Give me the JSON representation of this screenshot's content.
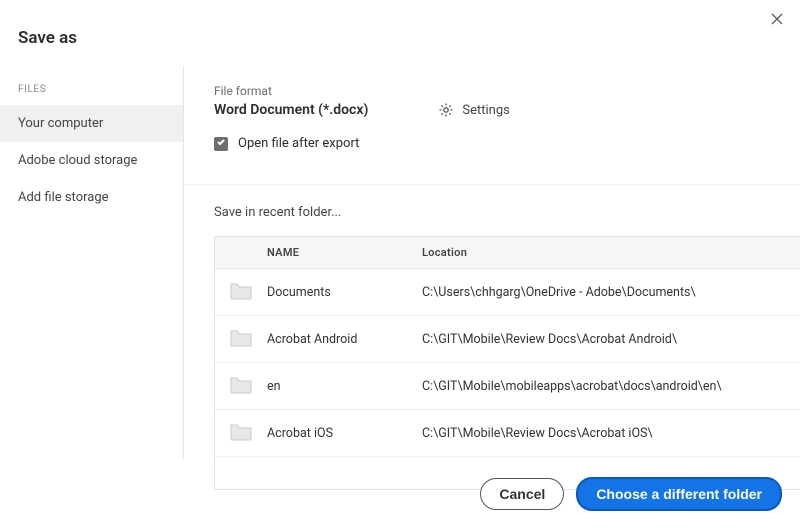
{
  "dialog": {
    "title": "Save as"
  },
  "sidebar": {
    "heading": "FILES",
    "items": [
      {
        "label": "Your computer",
        "selected": true
      },
      {
        "label": "Adobe cloud storage",
        "selected": false
      },
      {
        "label": "Add file storage",
        "selected": false
      }
    ]
  },
  "format": {
    "label": "File format",
    "value": "Word Document (*.docx)",
    "settings_label": "Settings",
    "open_after_export_label": "Open file after export",
    "open_after_export_checked": true
  },
  "recent": {
    "prompt": "Save in recent folder...",
    "columns": {
      "name": "NAME",
      "location": "Location"
    },
    "rows": [
      {
        "name": "Documents",
        "location": "C:\\Users\\chhgarg\\OneDrive - Adobe\\Documents\\"
      },
      {
        "name": "Acrobat Android",
        "location": "C:\\GIT\\Mobile\\Review Docs\\Acrobat Android\\"
      },
      {
        "name": "en",
        "location": "C:\\GIT\\Mobile\\mobileapps\\acrobat\\docs\\android\\en\\"
      },
      {
        "name": "Acrobat iOS",
        "location": "C:\\GIT\\Mobile\\Review Docs\\Acrobat iOS\\"
      }
    ]
  },
  "buttons": {
    "cancel": "Cancel",
    "choose": "Choose a different folder"
  }
}
